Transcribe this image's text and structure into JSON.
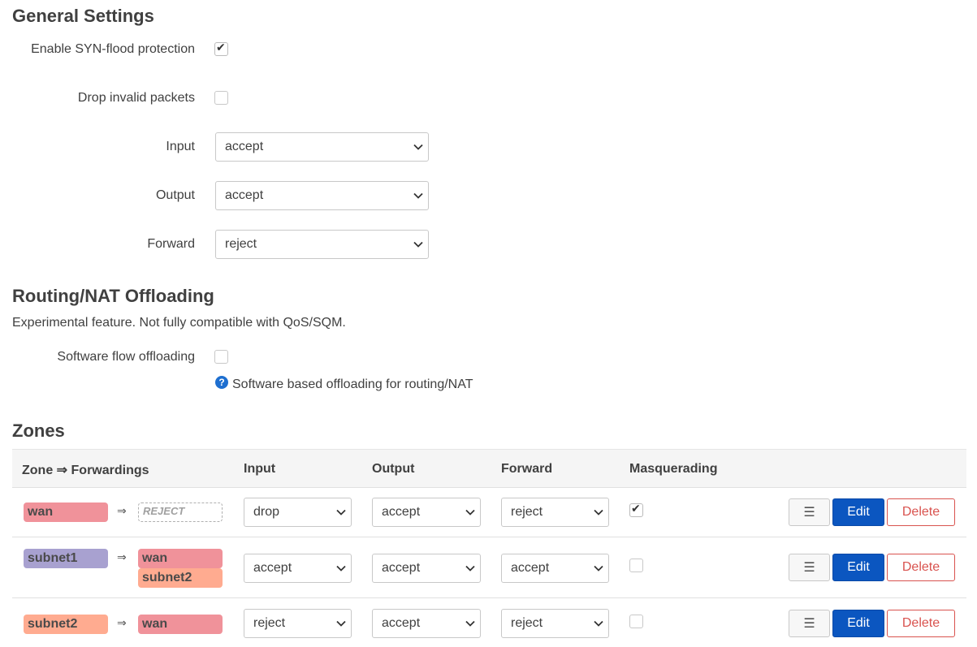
{
  "general": {
    "title": "General Settings",
    "syn_flood_label": "Enable SYN-flood protection",
    "syn_flood_checked": true,
    "drop_invalid_label": "Drop invalid packets",
    "drop_invalid_checked": false,
    "input_label": "Input",
    "input_value": "accept",
    "output_label": "Output",
    "output_value": "accept",
    "forward_label": "Forward",
    "forward_value": "reject"
  },
  "offloading": {
    "title": "Routing/NAT Offloading",
    "description": "Experimental feature. Not fully compatible with QoS/SQM.",
    "software_label": "Software flow offloading",
    "software_checked": false,
    "help_text": "Software based offloading for routing/NAT",
    "help_icon": "?"
  },
  "zones": {
    "title": "Zones",
    "headers": {
      "zone": "Zone ⇒ Forwardings",
      "input": "Input",
      "output": "Output",
      "forward": "Forward",
      "masquerading": "Masquerading"
    },
    "arrow": "⇒",
    "menu_glyph": "☰",
    "edit_label": "Edit",
    "delete_label": "Delete",
    "rows": [
      {
        "zone": "wan",
        "forwardings": [
          "REJECT"
        ],
        "input": "drop",
        "output": "accept",
        "forward": "reject",
        "masq": true
      },
      {
        "zone": "subnet1",
        "forwardings": [
          "wan",
          "subnet2"
        ],
        "input": "accept",
        "output": "accept",
        "forward": "accept",
        "masq": false
      },
      {
        "zone": "subnet2",
        "forwardings": [
          "wan"
        ],
        "input": "reject",
        "output": "accept",
        "forward": "reject",
        "masq": false
      }
    ]
  },
  "colors": {
    "wan": "#f0929a",
    "subnet1": "#a8a1d0",
    "subnet2": "#ffab90",
    "edit_button": "#0b56c0",
    "delete_button": "#d9534f",
    "help_icon": "#1e6fd0"
  }
}
